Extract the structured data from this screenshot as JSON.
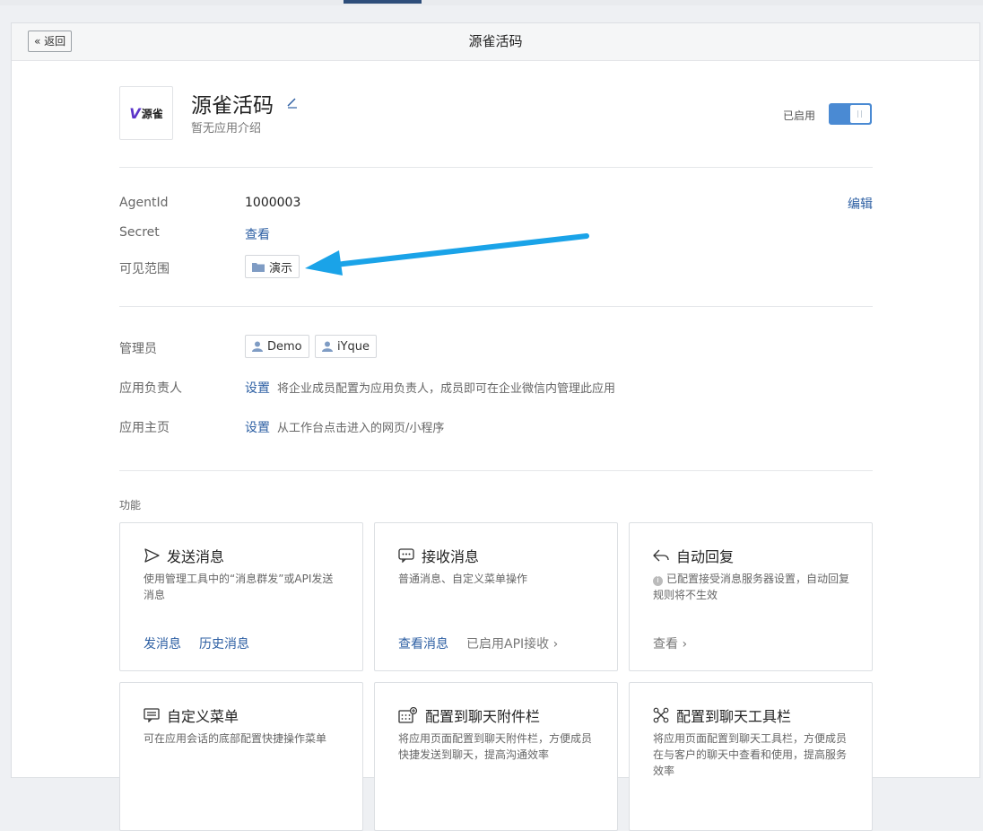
{
  "header": {
    "back_label": "« 返回",
    "title": "源雀活码"
  },
  "app": {
    "logo_text": "源雀",
    "name": "源雀活码",
    "description": "暂无应用介绍",
    "status_label": "已启用",
    "enabled": true
  },
  "details": {
    "agentid_label": "AgentId",
    "agentid_value": "1000003",
    "secret_label": "Secret",
    "secret_link": "查看",
    "visible_label": "可见范围",
    "visible_tag": "演示",
    "edit_link": "编辑"
  },
  "admins": {
    "label": "管理员",
    "items": [
      "Demo",
      "iYque"
    ]
  },
  "owner": {
    "label": "应用负责人",
    "link": "设置",
    "hint": "将企业成员配置为应用负责人，成员即可在企业微信内管理此应用"
  },
  "homepage": {
    "label": "应用主页",
    "link": "设置",
    "hint": "从工作台点击进入的网页/小程序"
  },
  "functions": {
    "section_label": "功能",
    "cards": [
      {
        "title": "发送消息",
        "icon": "send-icon",
        "desc": "使用管理工具中的“消息群发”或API发送消息",
        "actions": [
          "发消息",
          "历史消息"
        ]
      },
      {
        "title": "接收消息",
        "icon": "chat-bubble-icon",
        "desc": "普通消息、自定义菜单操作",
        "actions": [
          "查看消息",
          "已启用API接收 ›"
        ]
      },
      {
        "title": "自动回复",
        "icon": "reply-icon",
        "desc": "已配置接受消息服务器设置，自动回复规则将不生效",
        "actions": [
          "查看 ›"
        ]
      },
      {
        "title": "自定义菜单",
        "icon": "menu-icon",
        "desc": "可在应用会话的底部配置快捷操作菜单",
        "actions": []
      },
      {
        "title": "配置到聊天附件栏",
        "icon": "attachment-bar-icon",
        "desc": "将应用页面配置到聊天附件栏，方便成员快捷发送到聊天，提高沟通效率",
        "actions": []
      },
      {
        "title": "配置到聊天工具栏",
        "icon": "toolbar-icon",
        "desc": "将应用页面配置到聊天工具栏，方便成员在与客户的聊天中查看和使用，提高服务效率",
        "actions": []
      }
    ]
  },
  "colors": {
    "link": "#2d5fa3",
    "toggle": "#4a8ad3",
    "arrow": "#1aa3e8"
  }
}
